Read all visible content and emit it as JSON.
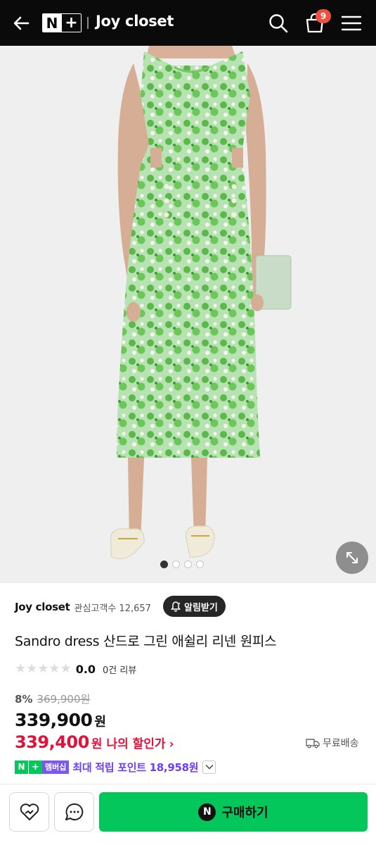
{
  "header": {
    "logo_n": "N",
    "logo_plus": "+",
    "store_title": "Joy closet",
    "cart_count": "9"
  },
  "gallery": {
    "total_images": 4,
    "current_index": 0
  },
  "store": {
    "name": "Joy closet",
    "fans_label": "관심고객수 12,657",
    "alert_label": "알림받기"
  },
  "product": {
    "title": "Sandro dress 산드로 그린 애쉴리 리넨 원피스",
    "rating_stars": "★★★★★",
    "rating_score": "0.0",
    "review_count": "0건 리뷰",
    "discount_rate": "8%",
    "original_price": "369,900원",
    "sale_price": "339,900",
    "won": "원",
    "member_price": "339,400",
    "member_won": "원",
    "member_label": "나의 할인가",
    "member_chevron": "›",
    "shipping": "무료배송"
  },
  "points": {
    "badge_n": "N",
    "badge_plus": "+",
    "badge_member": "멤버십",
    "text": "최대 적립 포인트 18,958원"
  },
  "bottom_bar": {
    "buy_icon": "N",
    "buy_label": "구매하기"
  },
  "colors": {
    "header_bg": "#0a0a0a",
    "buy_green": "#03c75a",
    "member_price_red": "#e0113a",
    "points_purple": "#6c3ff5",
    "cart_badge": "#f0513e",
    "dress_green": "#8fd18a"
  },
  "icons": {
    "back": "arrow-left-icon",
    "search": "search-icon",
    "cart": "shopping-bag-icon",
    "menu": "hamburger-menu-icon",
    "expand": "expand-diagonal-icon",
    "bell": "bell-icon",
    "shipping": "truck-icon",
    "like": "heart-icon",
    "chat": "chat-bubble-icon"
  }
}
